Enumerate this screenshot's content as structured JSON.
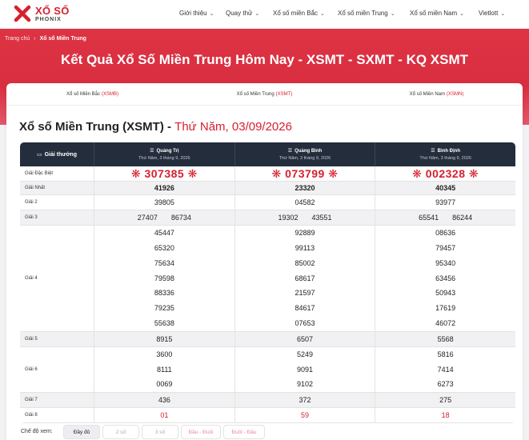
{
  "logo": {
    "line1": "XỔ SỐ",
    "line2": "PHONIX"
  },
  "nav": [
    {
      "label": "Giới thiệu"
    },
    {
      "label": "Quay thử"
    },
    {
      "label": "Xổ số miền Bắc"
    },
    {
      "label": "Xổ số miền Trung"
    },
    {
      "label": "Xổ số miền Nam"
    },
    {
      "label": "Vietlott"
    }
  ],
  "breadcrumb": {
    "home": "Trang chủ",
    "sep": "›",
    "current": "Xổ số Miền Trung"
  },
  "page_title": "Kết Quả Xổ Số Miền Trung Hôm Nay - XSMT - SXMT - KQ XSMT",
  "tabs": [
    {
      "label": "Xổ số Miền Bắc",
      "code": "(XSMB)"
    },
    {
      "label": "Xổ số Miền Trung",
      "code": "(XSMT)"
    },
    {
      "label": "Xổ số Miền Nam",
      "code": "(XSMN)"
    }
  ],
  "section": {
    "title": "Xổ số Miền Trung (XSMT) - ",
    "date": "Thứ Năm, 03/09/2026"
  },
  "table": {
    "header_label": "Giải thưởng",
    "provinces": [
      {
        "name": "Quảng Trị",
        "date": "Thứ Năm, 3 tháng 9, 2026"
      },
      {
        "name": "Quảng Bình",
        "date": "Thứ Năm, 3 tháng 9, 2026"
      },
      {
        "name": "Bình Định",
        "date": "Thứ Năm, 3 tháng 9, 2026"
      }
    ],
    "prizes": {
      "special": {
        "label": "Giải Đặc Biệt",
        "values": [
          "❋ 307385 ❋",
          "❋ 073799 ❋",
          "❋ 002328 ❋"
        ]
      },
      "first": {
        "label": "Giải Nhất",
        "values": [
          "41926",
          "23320",
          "40345"
        ]
      },
      "second": {
        "label": "Giải 2",
        "values": [
          "39805",
          "04582",
          "93977"
        ]
      },
      "third": {
        "label": "Giải 3",
        "values": [
          [
            "27407",
            "86734"
          ],
          [
            "19302",
            "43551"
          ],
          [
            "65541",
            "86244"
          ]
        ]
      },
      "fourth": {
        "label": "Giải 4",
        "values": [
          [
            "45447",
            "65320",
            "75634",
            "79598",
            "88336",
            "79235",
            "55638"
          ],
          [
            "92889",
            "99113",
            "85002",
            "68617",
            "21597",
            "84617",
            "07653"
          ],
          [
            "08636",
            "79457",
            "95340",
            "63456",
            "50943",
            "17619",
            "46072"
          ]
        ]
      },
      "fifth": {
        "label": "Giải 5",
        "values": [
          "8915",
          "6507",
          "5568"
        ]
      },
      "sixth": {
        "label": "Giải 6",
        "values": [
          [
            "3600",
            "8111",
            "0069"
          ],
          [
            "5249",
            "9091",
            "9102"
          ],
          [
            "5816",
            "7414",
            "6273"
          ]
        ]
      },
      "seventh": {
        "label": "Giải 7",
        "values": [
          "436",
          "372",
          "275"
        ]
      },
      "eighth": {
        "label": "Giải 8",
        "values": [
          "01",
          "59",
          "18"
        ]
      }
    }
  },
  "filter": {
    "label": "Chế độ xem:",
    "options": [
      "Đầy đủ",
      "2 số",
      "3 số",
      "Đầu - Đuôi",
      "Đuôi - Đầu"
    ],
    "selected": "Đầy đủ"
  },
  "colors": {
    "brand": "#d6202f",
    "header_dark": "#242d3c"
  }
}
